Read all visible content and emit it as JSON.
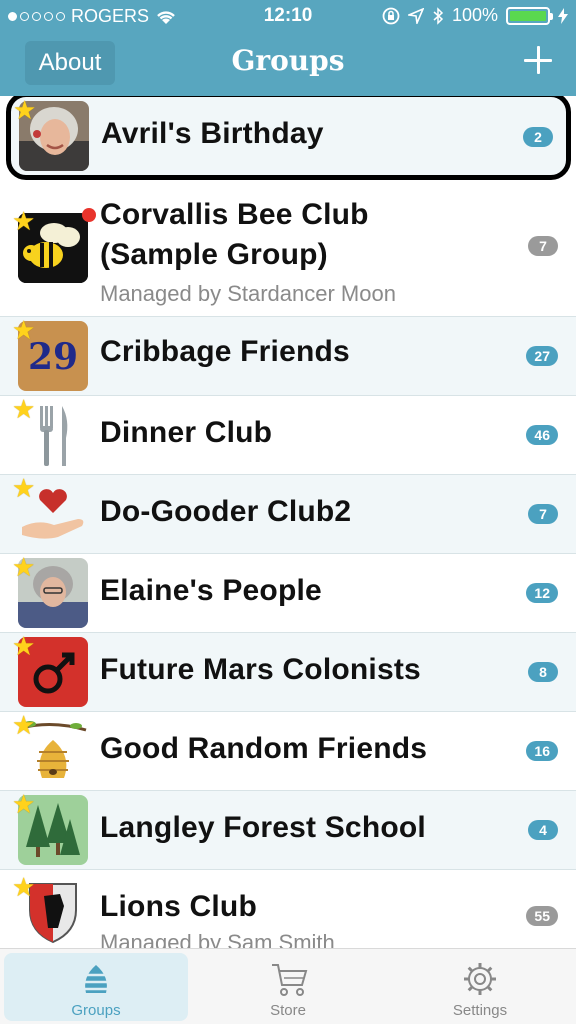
{
  "status_bar": {
    "carrier": "ROGERS",
    "time": "12:10",
    "battery": "100%",
    "battery_level": 1.0
  },
  "nav": {
    "about_label": "About",
    "title": "Groups"
  },
  "groups": [
    {
      "name": "Avril's Birthday",
      "subtitle": "",
      "count": "2",
      "badge": "blue",
      "icon": "avril-photo",
      "selected": true
    },
    {
      "name": "Corvallis Bee Club",
      "name2": "(Sample Group)",
      "subtitle": "Managed by Stardancer Moon",
      "count": "7",
      "badge": "grey",
      "icon": "bee-icon",
      "unread": true
    },
    {
      "name": "Cribbage Friends",
      "subtitle": "",
      "count": "27",
      "badge": "blue",
      "icon": "calendar-29-icon"
    },
    {
      "name": "Dinner Club",
      "subtitle": "",
      "count": "46",
      "badge": "blue",
      "icon": "fork-knife-icon"
    },
    {
      "name": "Do-Gooder Club2",
      "subtitle": "",
      "count": "7",
      "badge": "blue",
      "icon": "heart-hand-icon"
    },
    {
      "name": "Elaine's People",
      "subtitle": "",
      "count": "12",
      "badge": "blue",
      "icon": "elaine-photo"
    },
    {
      "name": "Future Mars Colonists",
      "subtitle": "",
      "count": "8",
      "badge": "blue",
      "icon": "mars-icon"
    },
    {
      "name": "Good Random Friends",
      "subtitle": "",
      "count": "16",
      "badge": "blue",
      "icon": "beehive-icon"
    },
    {
      "name": "Langley Forest School",
      "subtitle": "",
      "count": "4",
      "badge": "blue",
      "icon": "trees-icon"
    },
    {
      "name": "Lions Club",
      "subtitle": "Managed by Sam Smith",
      "count": "55",
      "badge": "grey",
      "icon": "lion-shield-icon"
    }
  ],
  "tabs": [
    {
      "label": "Groups",
      "icon": "beehive-tab-icon",
      "active": true
    },
    {
      "label": "Store",
      "icon": "cart-icon",
      "active": false
    },
    {
      "label": "Settings",
      "icon": "gear-icon",
      "active": false
    }
  ],
  "colors": {
    "nav_bar": "#58a6bf",
    "badge_blue": "#4ba1c0",
    "badge_grey": "#9a9a9a",
    "star": "#ffd21c"
  }
}
